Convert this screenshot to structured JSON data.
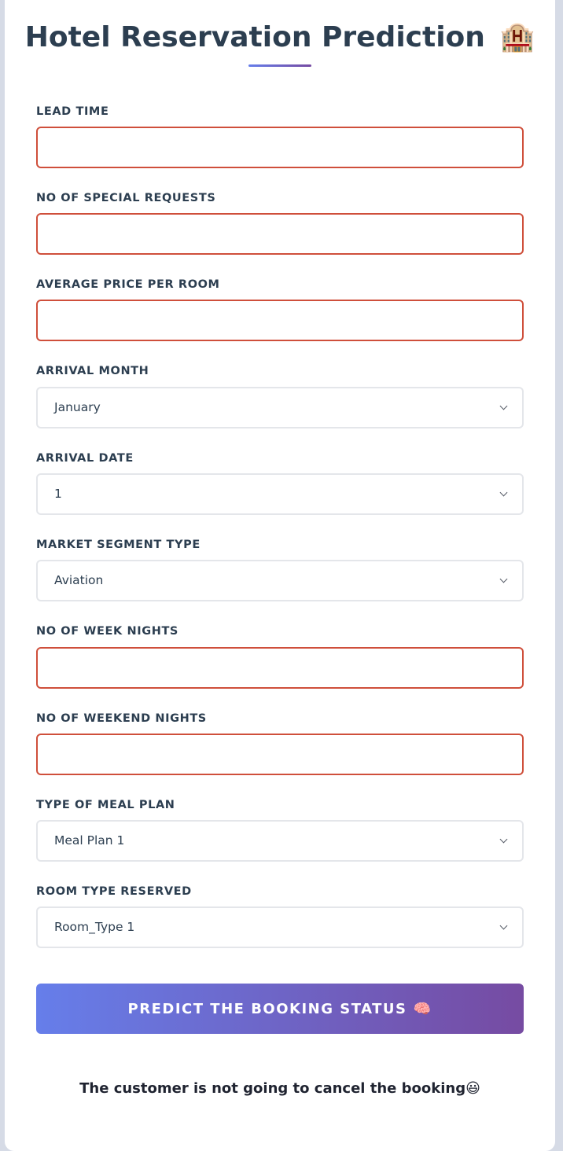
{
  "header": {
    "title": "Hotel Reservation Prediction",
    "title_icon": "🏨"
  },
  "fields": {
    "lead_time": {
      "label": "LEAD TIME",
      "value": ""
    },
    "no_of_special_requests": {
      "label": "NO OF SPECIAL REQUESTS",
      "value": ""
    },
    "avg_price_per_room": {
      "label": "AVERAGE PRICE PER ROOM",
      "value": ""
    },
    "arrival_month": {
      "label": "ARRIVAL MONTH",
      "selected": "January"
    },
    "arrival_date": {
      "label": "ARRIVAL DATE",
      "selected": "1"
    },
    "market_segment_type": {
      "label": "MARKET SEGMENT TYPE",
      "selected": "Aviation"
    },
    "no_of_week_nights": {
      "label": "NO OF WEEK NIGHTS",
      "value": ""
    },
    "no_of_weekend_nights": {
      "label": "NO OF WEEKEND NIGHTS",
      "value": ""
    },
    "type_of_meal_plan": {
      "label": "TYPE OF MEAL PLAN",
      "selected": "Meal Plan 1"
    },
    "room_type_reserved": {
      "label": "ROOM TYPE RESERVED",
      "selected": "Room_Type 1"
    }
  },
  "submit": {
    "label": "PREDICT THE BOOKING STATUS",
    "icon": "🧠"
  },
  "result": {
    "message": "The customer is not going to cancel the booking😃"
  },
  "colors": {
    "accent_start": "#667eea",
    "accent_end": "#764ba2",
    "invalid_border": "#cf4f3b",
    "heading": "#2c3e50"
  }
}
